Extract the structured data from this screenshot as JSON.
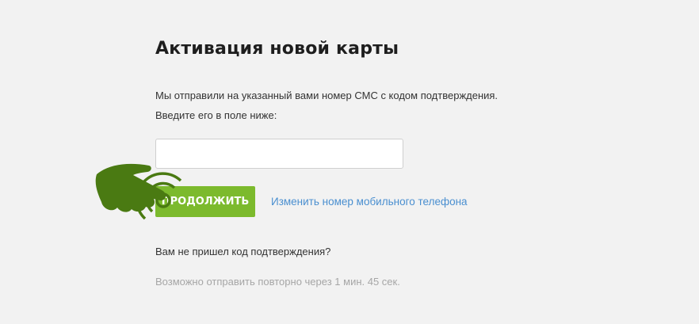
{
  "page": {
    "title": "Активация новой карты",
    "info_line_1": "Мы отправили на указанный вами номер СМС с кодом подтверждения.",
    "info_line_2": "Введите его в поле ниже:"
  },
  "form": {
    "code_input_value": "",
    "continue_label": "ПРОДОЛЖИТЬ",
    "change_phone_link": "Изменить номер мобильного телефона",
    "no_code_text": "Вам не пришел код подтверждения?",
    "resend_text": "Возможно отправить повторно через 1 мин. 45 сек."
  },
  "colors": {
    "button_green": "#7cba2d",
    "hand_green": "#4a7a12",
    "link_blue": "#4a8fd0",
    "muted_gray": "#a6a6a6",
    "background": "#f2f2f2"
  },
  "icons": {
    "tap_hint": "pointing-hand-tap-icon"
  }
}
